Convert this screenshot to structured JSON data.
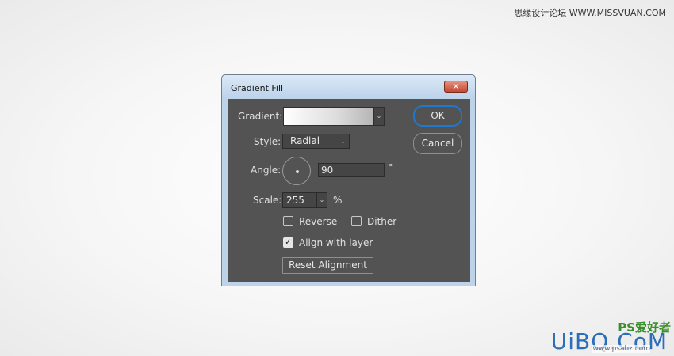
{
  "watermark": {
    "top_text": "思缘设计论坛 WWW.MISSVUAN.COM",
    "ps_text": "PS爱好者",
    "brand": "UiBQ.CoM",
    "site": "www.psahz.com"
  },
  "dialog": {
    "title": "Gradient Fill",
    "close_glyph": "✕",
    "gradient": {
      "label": "Gradient:",
      "colors": [
        "#ffffff",
        "#b6b6b6"
      ]
    },
    "style": {
      "label": "Style:",
      "value": "Radial"
    },
    "angle": {
      "label": "Angle:",
      "value": "90",
      "unit": "°"
    },
    "scale": {
      "label": "Scale:",
      "value": "255",
      "unit": "%"
    },
    "reverse": {
      "label": "Reverse",
      "checked": false
    },
    "dither": {
      "label": "Dither",
      "checked": false
    },
    "align": {
      "label": "Align with layer",
      "checked": true
    },
    "reset_label": "Reset Alignment",
    "ok_label": "OK",
    "cancel_label": "Cancel"
  },
  "colors": {
    "panel": "#535353",
    "accent": "#1e78d0",
    "close": "#c44a30"
  }
}
